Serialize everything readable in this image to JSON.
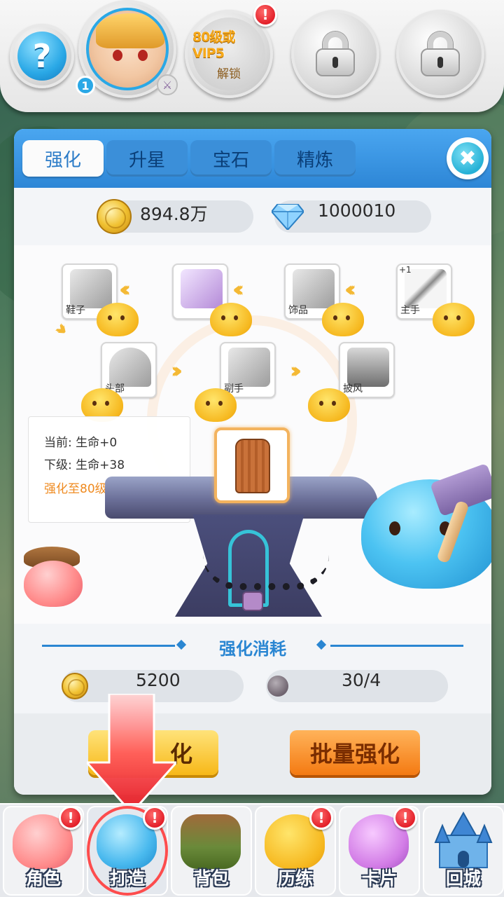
{
  "top_bar": {
    "unlock_line1": "80级或VIP5",
    "unlock_line2": "解锁",
    "help_symbol": "?",
    "alert_symbol": "!",
    "level_badge": "1"
  },
  "panel": {
    "tabs": [
      {
        "label": "强化",
        "active": true
      },
      {
        "label": "升星",
        "active": false
      },
      {
        "label": "宝石",
        "active": false
      },
      {
        "label": "精炼",
        "active": false
      }
    ],
    "close_symbol": "✖",
    "gold": "894.8万",
    "diamonds": "1000010"
  },
  "equipment": {
    "slots": [
      {
        "label": "鞋子",
        "plus": ""
      },
      {
        "label": "",
        "plus": ""
      },
      {
        "label": "饰品",
        "plus": ""
      },
      {
        "label": "主手",
        "plus": "+1"
      },
      {
        "label": "头部",
        "plus": ""
      },
      {
        "label": "副手",
        "plus": ""
      },
      {
        "label": "披风",
        "plus": ""
      }
    ],
    "info": {
      "current": "当前: 生命+0",
      "next": "下级: 生命+38",
      "hint": "强化至80级可精炼"
    }
  },
  "cost": {
    "title": "强化消耗",
    "gold_cost": "5200",
    "stone_cost": "30/4"
  },
  "buttons": {
    "enhance": "强化",
    "enhance_visible": "化",
    "batch": "批量强化"
  },
  "bottom_nav": [
    {
      "label": "角色",
      "alert": true
    },
    {
      "label": "打造",
      "alert": true,
      "active": true
    },
    {
      "label": "背包",
      "alert": false
    },
    {
      "label": "历练",
      "alert": true
    },
    {
      "label": "卡片",
      "alert": true
    },
    {
      "label": "回城",
      "alert": false
    }
  ],
  "colors": {
    "accent_blue": "#2a86d2",
    "hint_orange": "#ef8a1f",
    "alert_red": "#e3202a",
    "button_yellow": "#f7b818",
    "button_orange": "#f47a12"
  }
}
